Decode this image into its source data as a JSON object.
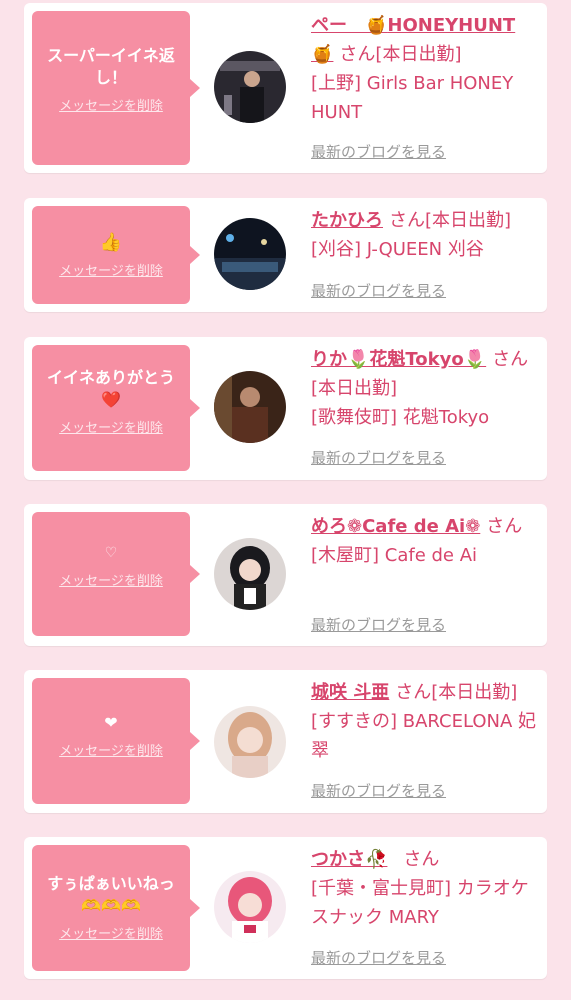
{
  "cards": [
    {
      "message": "スーパーイイネ返し！",
      "delete_label": "メッセージを削除",
      "name": "ペー　🍯HONEYHUNT\n🍯",
      "san": "さん[本日出勤]",
      "shop": "[上野] Girls Bar HONEY HUNT",
      "blog": "最新のブログを見る"
    },
    {
      "message": "👍",
      "delete_label": "メッセージを削除",
      "name": "たかひろ",
      "san": "さん[本日出勤]",
      "shop": "[刈谷] J-QUEEN 刈谷",
      "blog": "最新のブログを見る"
    },
    {
      "message": "イイネありがとう❤️",
      "delete_label": "メッセージを削除",
      "name": "りか🌷花魁Tokyo🌷",
      "san": "さん[本日出勤]",
      "shop": "[歌舞伎町] 花魁Tokyo",
      "blog": "最新のブログを見る"
    },
    {
      "message": "♡",
      "delete_label": "メッセージを削除",
      "name": "めろ❁Cafe de Ai❁",
      "san": "さん",
      "shop": "[木屋町] Cafe de Ai",
      "blog": "最新のブログを見る"
    },
    {
      "message": "❤",
      "delete_label": "メッセージを削除",
      "name": "城咲 斗亜",
      "san": "さん[本日出勤]",
      "shop": "[すすきの] BARCELONA 妃翠",
      "blog": "最新のブログを見る"
    },
    {
      "message": "すぅぱぁいいねっ🫶🫶🫶",
      "delete_label": "メッセージを削除",
      "name": "つかさ🥀",
      "san": "さん",
      "shop": "[千葉・富士見町] カラオケスナック MARY",
      "blog": "最新のブログを見る"
    }
  ]
}
